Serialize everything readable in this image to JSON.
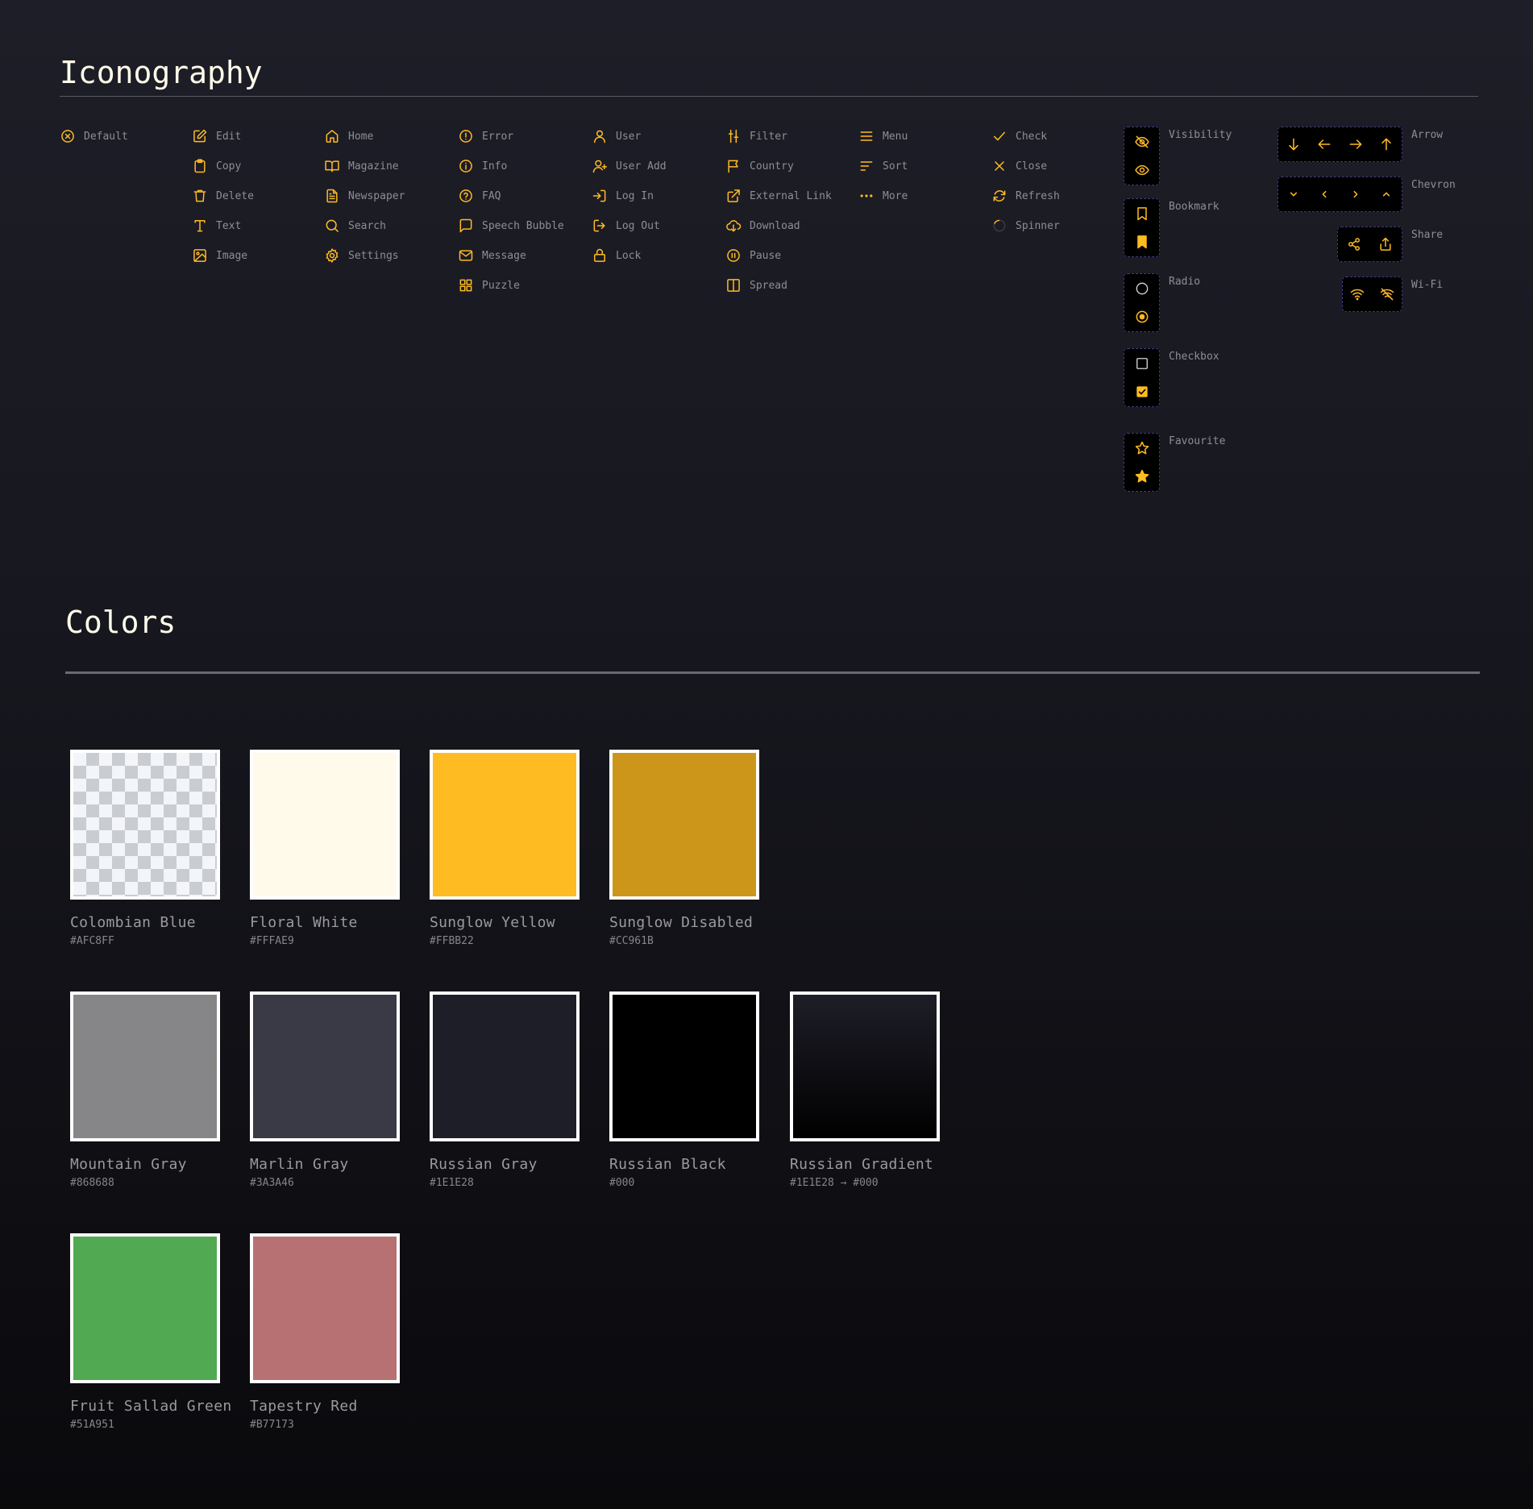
{
  "iconography": {
    "title": "Iconography",
    "columns": [
      {
        "items": [
          {
            "label": "Default",
            "icon": "x-circle-icon"
          }
        ]
      },
      {
        "items": [
          {
            "label": "Edit",
            "icon": "edit-icon"
          },
          {
            "label": "Copy",
            "icon": "copy-icon"
          },
          {
            "label": "Delete",
            "icon": "trash-icon"
          },
          {
            "label": "Text",
            "icon": "text-icon"
          },
          {
            "label": "Image",
            "icon": "image-icon"
          }
        ]
      },
      {
        "items": [
          {
            "label": "Home",
            "icon": "home-icon"
          },
          {
            "label": "Magazine",
            "icon": "book-open-icon"
          },
          {
            "label": "Newspaper",
            "icon": "file-text-icon"
          },
          {
            "label": "Search",
            "icon": "search-icon"
          },
          {
            "label": "Settings",
            "icon": "gear-icon"
          }
        ]
      },
      {
        "items": [
          {
            "label": "Error",
            "icon": "alert-circle-icon"
          },
          {
            "label": "Info",
            "icon": "info-icon"
          },
          {
            "label": "FAQ",
            "icon": "help-circle-icon"
          },
          {
            "label": "Speech Bubble",
            "icon": "speech-bubble-icon"
          },
          {
            "label": "Message",
            "icon": "mail-icon"
          },
          {
            "label": "Puzzle",
            "icon": "grid-icon"
          }
        ]
      },
      {
        "items": [
          {
            "label": "User",
            "icon": "user-icon"
          },
          {
            "label": "User Add",
            "icon": "user-add-icon"
          },
          {
            "label": "Log In",
            "icon": "log-in-icon"
          },
          {
            "label": "Log Out",
            "icon": "log-out-icon"
          },
          {
            "label": "Lock",
            "icon": "lock-icon"
          }
        ]
      },
      {
        "items": [
          {
            "label": "Filter",
            "icon": "filter-icon"
          },
          {
            "label": "Country",
            "icon": "flag-icon"
          },
          {
            "label": "External Link",
            "icon": "external-link-icon"
          },
          {
            "label": "Download",
            "icon": "cloud-download-icon"
          },
          {
            "label": "Pause",
            "icon": "pause-circle-icon"
          },
          {
            "label": "Spread",
            "icon": "columns-icon"
          }
        ]
      },
      {
        "items": [
          {
            "label": "Menu",
            "icon": "menu-icon"
          },
          {
            "label": "Sort",
            "icon": "sort-icon"
          },
          {
            "label": "More",
            "icon": "more-icon"
          }
        ]
      },
      {
        "items": [
          {
            "label": "Check",
            "icon": "check-icon"
          },
          {
            "label": "Close",
            "icon": "close-icon"
          },
          {
            "label": "Refresh",
            "icon": "refresh-icon"
          },
          {
            "label": "Spinner",
            "icon": "spinner-icon"
          }
        ]
      }
    ],
    "state_groups": [
      {
        "label": "Visibility",
        "icons": [
          "eye-off-icon",
          "eye-icon"
        ]
      },
      {
        "label": "Bookmark",
        "icons": [
          "bookmark-icon",
          "bookmark-filled-icon"
        ]
      },
      {
        "label": "Radio",
        "icons": [
          "radio-empty-icon",
          "radio-selected-icon"
        ]
      },
      {
        "label": "Checkbox",
        "icons": [
          "checkbox-empty-icon",
          "checkbox-checked-icon"
        ]
      },
      {
        "label": "Favourite",
        "icons": [
          "star-icon",
          "star-filled-icon"
        ]
      }
    ],
    "direction_groups": [
      {
        "label": "Arrow",
        "icons": [
          "arrow-down-icon",
          "arrow-left-icon",
          "arrow-right-icon",
          "arrow-up-icon"
        ]
      },
      {
        "label": "Chevron",
        "icons": [
          "chevron-down-icon",
          "chevron-left-icon",
          "chevron-right-icon",
          "chevron-up-icon"
        ]
      },
      {
        "label": "Share",
        "icons": [
          "share-nodes-icon",
          "share-upload-icon"
        ]
      },
      {
        "label": "Wi-Fi",
        "icons": [
          "wifi-icon",
          "wifi-off-icon"
        ]
      }
    ],
    "accent_color": "#FFBB22"
  },
  "colors": {
    "title": "Colors",
    "rows": [
      [
        {
          "name": "Colombian Blue",
          "hex": "#AFC8FF",
          "fill": "checker"
        },
        {
          "name": "Floral White",
          "hex": "#FFFAE9",
          "fill": "#FFFAE9"
        },
        {
          "name": "Sunglow Yellow",
          "hex": "#FFBB22",
          "fill": "#FFBB22"
        },
        {
          "name": "Sunglow Disabled",
          "hex": "#CC961B",
          "fill": "#CC961B"
        }
      ],
      [
        {
          "name": "Mountain Gray",
          "hex": "#868688",
          "fill": "#868688"
        },
        {
          "name": "Marlin Gray",
          "hex": "#3A3A46",
          "fill": "#3A3A46"
        },
        {
          "name": "Russian Gray",
          "hex": "#1E1E28",
          "fill": "#1E1E28"
        },
        {
          "name": "Russian Black",
          "hex": "#000",
          "fill": "#000000"
        },
        {
          "name": "Russian Gradient",
          "hex": "#1E1E28 → #000",
          "fill": "linear-gradient(180deg,#1E1E28,#000)"
        }
      ],
      [
        {
          "name": "Fruit Sallad Green",
          "hex": "#51A951",
          "fill": "#51A951"
        },
        {
          "name": "Tapestry Red",
          "hex": "#B77173",
          "fill": "#B77173"
        }
      ]
    ]
  }
}
